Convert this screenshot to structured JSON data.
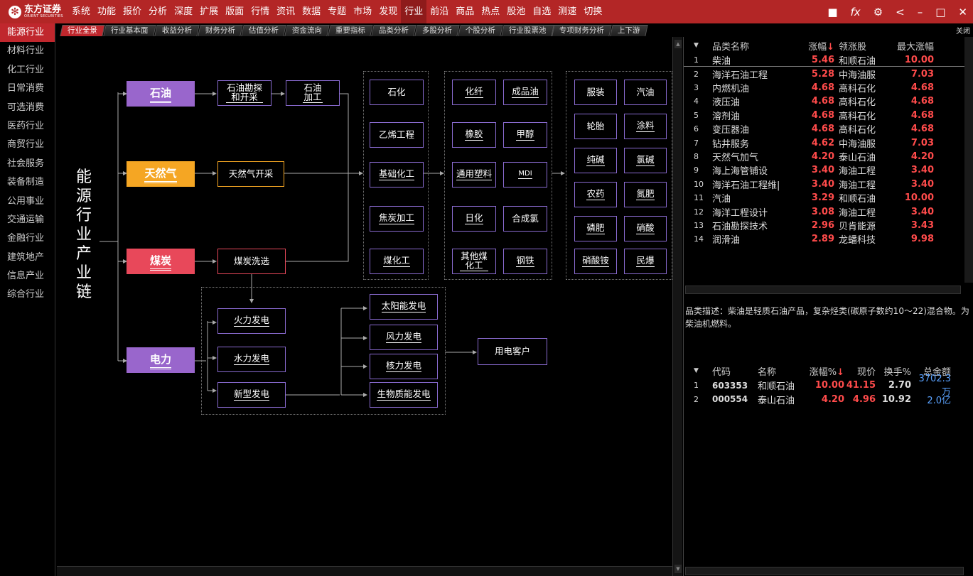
{
  "app": {
    "logo_cn": "东方证券",
    "logo_en": "ORIENT SECURITIES",
    "menu": [
      "系统",
      "功能",
      "报价",
      "分析",
      "深度",
      "扩展",
      "版面",
      "行情",
      "资讯",
      "数据",
      "专题",
      "市场",
      "发现",
      "行业",
      "前沿",
      "商品",
      "热点",
      "股池",
      "自选",
      "测速",
      "切换"
    ],
    "active_menu": "行业",
    "win_controls": [
      "■",
      "fx",
      "⚙",
      "<",
      "–",
      "□",
      "✕"
    ]
  },
  "sidebar": {
    "items": [
      "能源行业",
      "材料行业",
      "化工行业",
      "日常消费",
      "可选消费",
      "医药行业",
      "商贸行业",
      "社会服务",
      "装备制造",
      "公用事业",
      "交通运输",
      "金融行业",
      "建筑地产",
      "信息产业",
      "综合行业"
    ],
    "active": "能源行业"
  },
  "tabs": {
    "items": [
      "行业全景",
      "行业基本面",
      "收益分析",
      "财务分析",
      "估值分析",
      "资金流向",
      "重要指标",
      "品类分析",
      "多股分析",
      "个股分析",
      "行业股票池",
      "专项财务分析",
      "上下游"
    ],
    "active": "行业全景",
    "close_label": "关闭"
  },
  "diagram": {
    "title": [
      "能",
      "源",
      "行",
      "业",
      "产",
      "业",
      "链"
    ],
    "categories": {
      "oil": {
        "label": "石油",
        "color": "#9966cc"
      },
      "gas": {
        "label": "天然气",
        "color": "#f5a623"
      },
      "coal": {
        "label": "煤炭",
        "color": "#e8485a"
      },
      "power": {
        "label": "电力",
        "color": "#9966cc"
      }
    },
    "oil_chain": [
      "石油勘探和开采",
      "石油加工"
    ],
    "gas_chain": [
      "天然气开采"
    ],
    "coal_chain": [
      "煤炭洗选"
    ],
    "col1": [
      "石化",
      "乙烯工程",
      "基础化工",
      "焦炭加工",
      "煤化工"
    ],
    "col2": [
      "化纤",
      "成品油",
      "橡胶",
      "甲醇",
      "通用塑料",
      "MDI",
      "日化",
      "合成氯",
      "其他煤化工",
      "钢铁"
    ],
    "col3": [
      "服装",
      "汽油",
      "轮胎",
      "涂料",
      "纯碱",
      "氯碱",
      "农药",
      "氮肥",
      "磷肥",
      "硝酸",
      "硝酸铵",
      "民爆"
    ],
    "power_left": [
      "火力发电",
      "水力发电",
      "新型发电"
    ],
    "power_right": [
      "太阳能发电",
      "风力发电",
      "核力发电",
      "生物质能发电"
    ],
    "power_end": "用电客户"
  },
  "table1": {
    "headers": [
      "品类名称",
      "涨幅",
      "领涨股",
      "最大涨幅"
    ],
    "sort_indicator": "↓",
    "rows": [
      {
        "n": "1",
        "name": "柴油",
        "chg": "5.46",
        "lead": "和顺石油",
        "max": "10.00"
      },
      {
        "n": "2",
        "name": "海洋石油工程",
        "chg": "5.28",
        "lead": "中海油服",
        "max": "7.03"
      },
      {
        "n": "3",
        "name": "内燃机油",
        "chg": "4.68",
        "lead": "高科石化",
        "max": "4.68"
      },
      {
        "n": "4",
        "name": "液压油",
        "chg": "4.68",
        "lead": "高科石化",
        "max": "4.68"
      },
      {
        "n": "5",
        "name": "溶剂油",
        "chg": "4.68",
        "lead": "高科石化",
        "max": "4.68"
      },
      {
        "n": "6",
        "name": "变压器油",
        "chg": "4.68",
        "lead": "高科石化",
        "max": "4.68"
      },
      {
        "n": "7",
        "name": "钻井服务",
        "chg": "4.62",
        "lead": "中海油服",
        "max": "7.03"
      },
      {
        "n": "8",
        "name": "天然气加气",
        "chg": "4.20",
        "lead": "泰山石油",
        "max": "4.20"
      },
      {
        "n": "9",
        "name": "海上海管铺设",
        "chg": "3.40",
        "lead": "海油工程",
        "max": "3.40"
      },
      {
        "n": "10",
        "name": "海洋石油工程维|",
        "chg": "3.40",
        "lead": "海油工程",
        "max": "3.40"
      },
      {
        "n": "11",
        "name": "汽油",
        "chg": "3.29",
        "lead": "和顺石油",
        "max": "10.00"
      },
      {
        "n": "12",
        "name": "海洋工程设计",
        "chg": "3.08",
        "lead": "海油工程",
        "max": "3.40"
      },
      {
        "n": "13",
        "name": "石油勘探技术",
        "chg": "2.96",
        "lead": "贝肯能源",
        "max": "3.43"
      },
      {
        "n": "14",
        "name": "润滑油",
        "chg": "2.89",
        "lead": "龙蟠科技",
        "max": "9.98"
      }
    ]
  },
  "description": "品类描述：柴油是轻质石油产品，复杂烃类(碳原子数约10～22)混合物。为柴油机燃料。",
  "table2": {
    "headers": [
      "代码",
      "名称",
      "涨幅%",
      "现价",
      "换手%",
      "总金额"
    ],
    "sort_indicator": "↓",
    "rows": [
      {
        "n": "1",
        "code": "603353",
        "name": "和顺石油",
        "chg": "10.00",
        "price": "41.15",
        "turn": "2.70",
        "amt": "3702.3万"
      },
      {
        "n": "2",
        "code": "000554",
        "name": "泰山石油",
        "chg": "4.20",
        "price": "4.96",
        "turn": "10.92",
        "amt": "2.0亿"
      }
    ]
  }
}
